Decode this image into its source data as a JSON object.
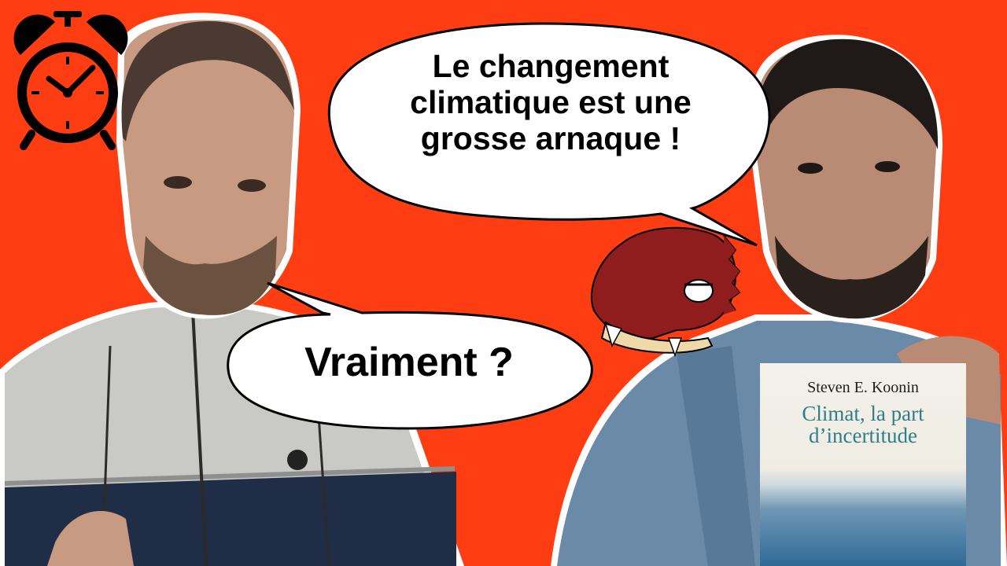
{
  "scene": {
    "background_color": "#ff3d12",
    "icons": [
      "alarm-clock-icon",
      "dragon-mascot-icon",
      "iceberg-icon"
    ]
  },
  "speech_bubbles": {
    "top": {
      "lines": [
        "Le changement",
        "climatique est une",
        "grosse arnaque !"
      ]
    },
    "bottom": {
      "text": "Vraiment ?"
    }
  },
  "book": {
    "author": "Steven E. Koonin",
    "title_lines": [
      "Climat, la part",
      "d’incertitude"
    ],
    "title_color": "#2f7f86"
  }
}
